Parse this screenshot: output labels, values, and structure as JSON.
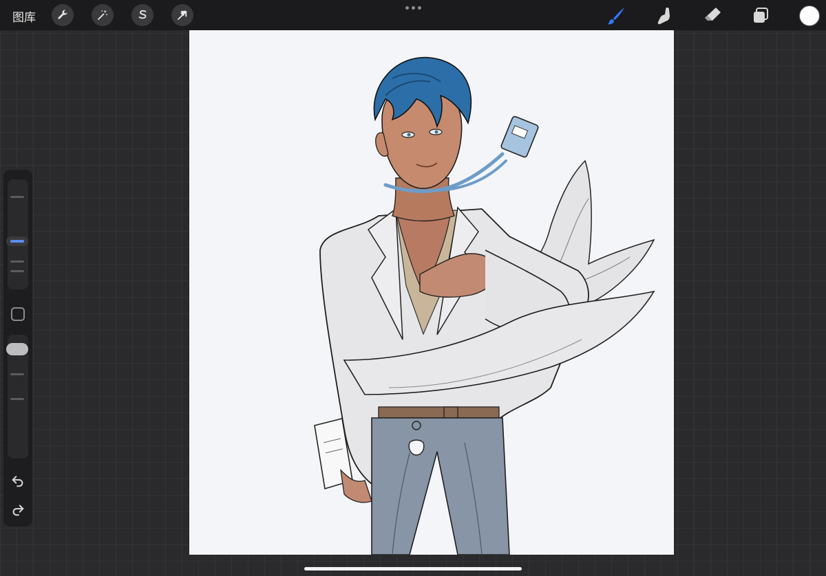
{
  "topbar": {
    "gallery_label": "图库",
    "left_tools": [
      "wrench-icon",
      "magic-wand-icon",
      "selection-s-icon",
      "transform-arrow-icon"
    ],
    "right_tools": [
      "brush-icon",
      "smudge-icon",
      "eraser-icon",
      "layers-icon"
    ],
    "active_tool": "brush-icon",
    "accent_color": "#2f7bf6",
    "current_color": "#ffffff"
  },
  "sidebar": {
    "brush_size_level": 0.55,
    "opacity_level": 0.75,
    "icons": [
      "undo-icon",
      "redo-icon"
    ]
  },
  "canvas": {
    "background": "#f4f5f8"
  }
}
